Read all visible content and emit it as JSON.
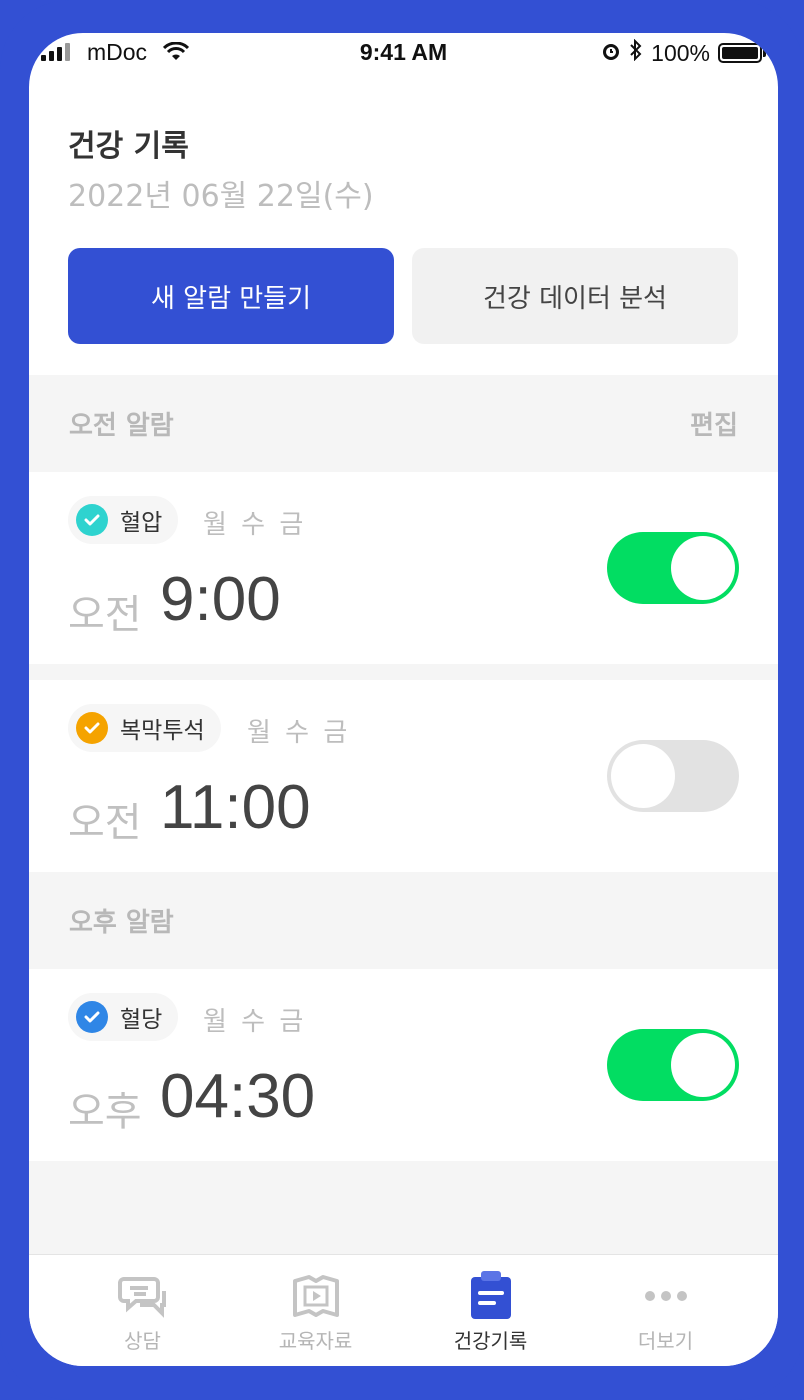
{
  "status_bar": {
    "carrier": "mDoc",
    "time": "9:41 AM",
    "battery": "100%"
  },
  "header": {
    "title": "건강 기록",
    "date": "2022년 06월 22일(수)"
  },
  "actions": {
    "new_alarm": "새 알람 만들기",
    "analyze": "건강 데이터 분석"
  },
  "morning_section": {
    "title": "오전 알람",
    "edit": "편집"
  },
  "afternoon_section": {
    "title": "오후 알람"
  },
  "alarms": [
    {
      "tag": "혈압",
      "days": "월 수 금",
      "ampm": "오전",
      "time": "9:00",
      "enabled": true,
      "check_color": "#2ed3cf"
    },
    {
      "tag": "복막투석",
      "days": "월 수 금",
      "ampm": "오전",
      "time": "11:00",
      "enabled": false,
      "check_color": "#f5a300"
    },
    {
      "tag": "혈당",
      "days": "월 수 금",
      "ampm": "오후",
      "time": "04:30",
      "enabled": true,
      "check_color": "#2f86e6"
    }
  ],
  "tabs": [
    {
      "label": "상담",
      "icon": "chat-icon",
      "active": false
    },
    {
      "label": "교육자료",
      "icon": "book-video-icon",
      "active": false
    },
    {
      "label": "건강기록",
      "icon": "clipboard-icon",
      "active": true
    },
    {
      "label": "더보기",
      "icon": "more-dots-icon",
      "active": false
    }
  ],
  "colors": {
    "brand": "#3350d3",
    "toggle_on": "#02dd62",
    "toggle_off": "#e2e2e2"
  }
}
